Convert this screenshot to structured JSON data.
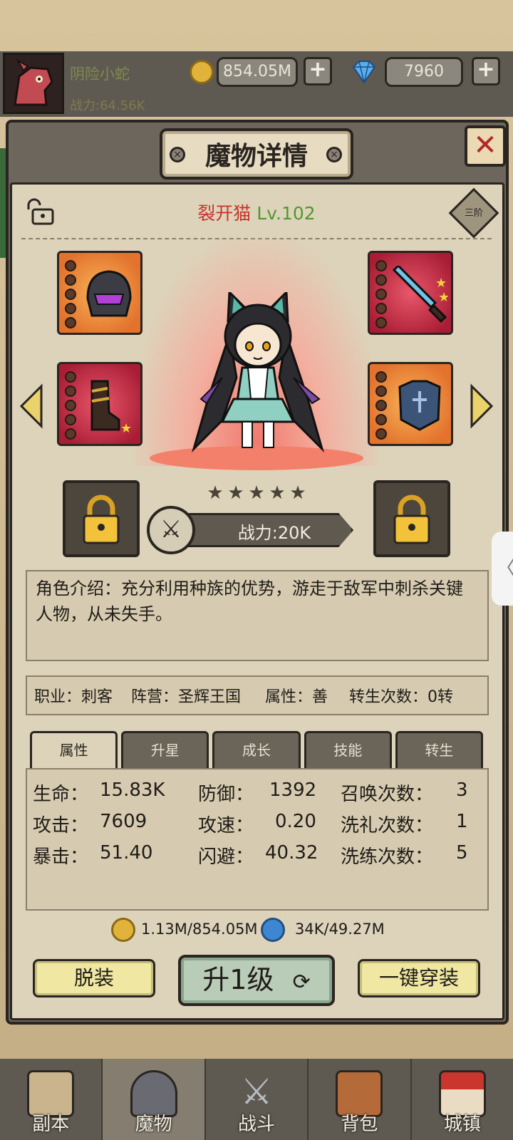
{
  "player": {
    "name": "阴险小蛇",
    "power": "战力:64.56K",
    "coins": "854.05M",
    "gems": "7960"
  },
  "panel": {
    "title": "魔物详情",
    "monster_name": "裂开猫",
    "monster_level": "Lv.102",
    "rank": "三阶",
    "stars": 5,
    "combat_power": "战力:20K",
    "description": "角色介绍：充分利用种族的优势，游走于敌军中刺杀关键人物，从未失手。"
  },
  "info": {
    "job": "职业：刺客",
    "camp": "阵营：圣辉王国",
    "attr": "属性：善",
    "rebirth": "转生次数：0转"
  },
  "tabs": [
    "属性",
    "升星",
    "成长",
    "技能",
    "转生"
  ],
  "stats": [
    {
      "label": "生命：",
      "value": "15.83K"
    },
    {
      "label": "防御：",
      "value": "1392"
    },
    {
      "label": "召唤次数：",
      "value": "3"
    },
    {
      "label": "攻击：",
      "value": "7609"
    },
    {
      "label": "攻速：",
      "value": "0.20"
    },
    {
      "label": "洗礼次数：",
      "value": "1"
    },
    {
      "label": "暴击：",
      "value": "51.40"
    },
    {
      "label": "闪避：",
      "value": "40.32"
    },
    {
      "label": "洗练次数：",
      "value": "5"
    }
  ],
  "resources": {
    "coin_cost": "1.13M/854.05M",
    "soul_cost": "34K/49.27M"
  },
  "buttons": {
    "unequip": "脱装",
    "level_up": "升1级",
    "equip_all": "一键穿装"
  },
  "nav": [
    "副本",
    "魔物",
    "战斗",
    "背包",
    "城镇"
  ],
  "colors": {
    "name_red": "#c9322b",
    "level_green": "#4f9a2a",
    "close_red": "#b2282a"
  }
}
